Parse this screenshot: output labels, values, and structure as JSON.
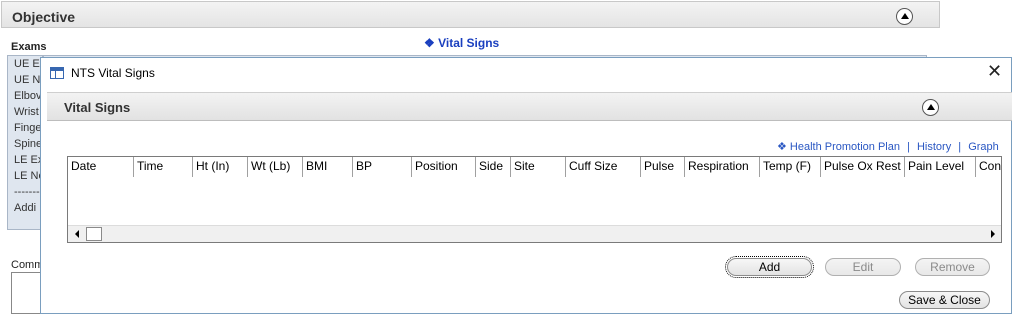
{
  "background": {
    "section_title": "Objective",
    "exams_label": "Exams",
    "vital_signs_link": "❖ Vital Signs",
    "exams_items": [
      "UE Ex",
      "UE N",
      "Elbov",
      "Wrist",
      "Finge",
      "Spine",
      "LE Ex",
      "LE Ne",
      "--------",
      "Addi"
    ],
    "comments_label": "Comm"
  },
  "dialog": {
    "title": "NTS Vital Signs",
    "close_label": "✕",
    "section_title": "Vital Signs",
    "links": {
      "health_promotion": "❖ Health Promotion Plan",
      "separator": "|",
      "history": "History",
      "graph": "Graph"
    },
    "grid": {
      "columns": [
        "Date",
        "Time",
        "Ht (In)",
        "Wt (Lb)",
        "BMI",
        "BP",
        "Position",
        "Side",
        "Site",
        "Cuff Size",
        "Pulse",
        "Respiration",
        "Temp (F)",
        "Pulse Ox Rest",
        "Pain Level",
        "Con"
      ],
      "rows": []
    },
    "buttons": {
      "add": "Add",
      "edit": "Edit",
      "remove": "Remove",
      "save_close": "Save & Close"
    }
  },
  "colors": {
    "link": "#2a57c3",
    "dialog_border": "#7a9ebf",
    "header_gradient": "#e4e4e4"
  }
}
